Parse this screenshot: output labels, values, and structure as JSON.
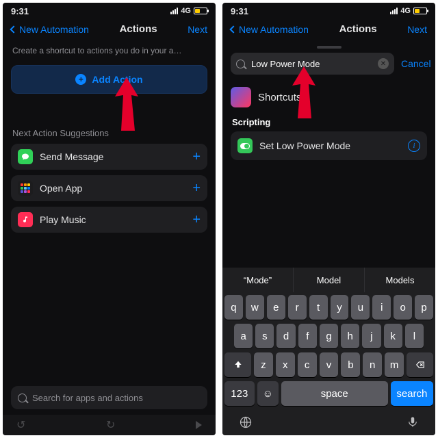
{
  "status": {
    "time": "9:31",
    "net": "4G"
  },
  "nav": {
    "back": "New Automation",
    "title": "Actions",
    "next": "Next"
  },
  "left": {
    "hint": "Create a shortcut to actions you do in your a…",
    "add_action": "Add Action",
    "suggestions_header": "Next Action Suggestions",
    "rows": [
      {
        "label": "Send Message"
      },
      {
        "label": "Open App"
      },
      {
        "label": "Play Music"
      }
    ],
    "search_placeholder": "Search for apps and actions"
  },
  "right": {
    "search_value": "Low Power Mode",
    "cancel": "Cancel",
    "shortcuts_label": "Shortcuts",
    "section": "Scripting",
    "action_label": "Set Low Power Mode"
  },
  "keyboard": {
    "predictions": [
      "“Mode”",
      "Model",
      "Models"
    ],
    "row1": [
      "q",
      "w",
      "e",
      "r",
      "t",
      "y",
      "u",
      "i",
      "o",
      "p"
    ],
    "row2": [
      "a",
      "s",
      "d",
      "f",
      "g",
      "h",
      "j",
      "k",
      "l"
    ],
    "row3": [
      "z",
      "x",
      "c",
      "v",
      "b",
      "n",
      "m"
    ],
    "numkey": "123",
    "space": "space",
    "search": "search"
  }
}
